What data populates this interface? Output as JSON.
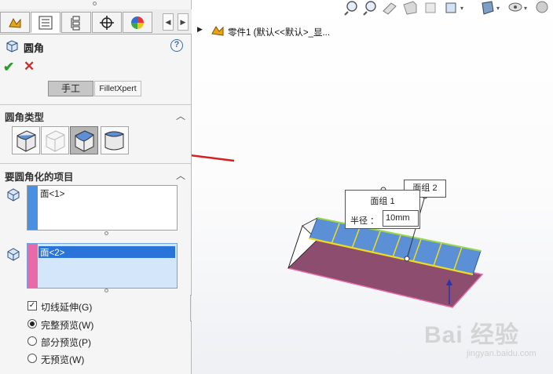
{
  "tabs": [
    {
      "name": "feature-manager-tab",
      "icon": "feature-tree-icon"
    },
    {
      "name": "property-manager-tab",
      "icon": "property-list-icon"
    },
    {
      "name": "config-manager-tab",
      "icon": "configuration-icon"
    },
    {
      "name": "dimxpert-tab",
      "icon": "crosshair-icon"
    },
    {
      "name": "appearance-tab",
      "icon": "appearance-pie-icon"
    }
  ],
  "property_manager": {
    "title": "圆角",
    "help": "?",
    "ok": "✔",
    "cancel": "✕",
    "mode_manual": "手工",
    "mode_filletxpert": "FilletXpert"
  },
  "fillet_type": {
    "title": "圆角类型",
    "options": [
      "constant-radius",
      "variable-radius",
      "face-fillet",
      "full-round"
    ],
    "selected_index": 2
  },
  "items": {
    "title": "要圆角化的项目",
    "list1": "面<1>",
    "list2": "面<2>",
    "tangent_propagation": "切线延伸(G)",
    "tangent_checked": true,
    "preview_full": "完整预览(W)",
    "preview_partial": "部分预览(P)",
    "preview_none": "无预览(W)",
    "preview_selected": "full"
  },
  "viewport": {
    "tree_path": "零件1  (默认<<默认>_显...",
    "callout_face1": "面组 1",
    "callout_face2": "面组 2",
    "radius_label": "半径 ：",
    "radius_value": "10mm",
    "watermark": "Bai 经验",
    "watermark_sub": "jingyan.baidu.com"
  },
  "colors": {
    "face_set_1": "#4a90e2",
    "face_set_2": "#e86aa8",
    "highlight": "#2a73d8",
    "annotation_arrow": "#d62020",
    "fillet_face": "#5b8fd6",
    "part_face": "#8d4d6e"
  }
}
